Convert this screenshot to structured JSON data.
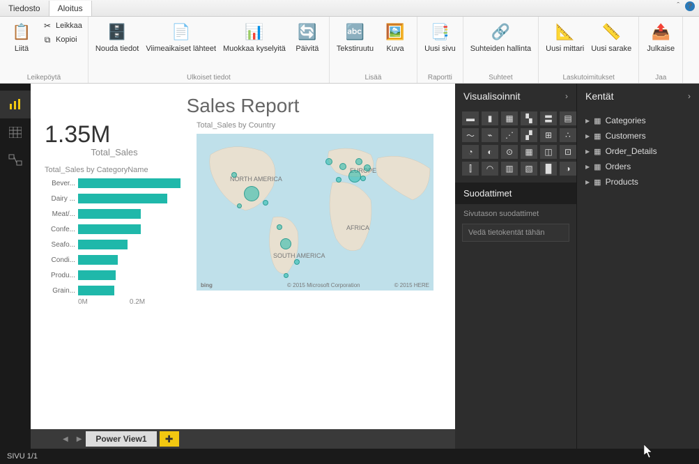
{
  "menu": {
    "file": "Tiedosto",
    "home": "Aloitus"
  },
  "ribbon": {
    "clipboard": {
      "paste": "Liitä",
      "cut": "Leikkaa",
      "copy": "Kopioi",
      "group": "Leikepöytä"
    },
    "external": {
      "getdata": "Nouda tiedot",
      "recent": "Viimeaikaiset lähteet",
      "edit": "Muokkaa kyselyitä",
      "refresh": "Päivitä",
      "group": "Ulkoiset tiedot"
    },
    "insert": {
      "textbox": "Tekstiruutu",
      "image": "Kuva",
      "group": "Lisää"
    },
    "report": {
      "newpage": "Uusi sivu",
      "group": "Raportti"
    },
    "relations": {
      "manage": "Suhteiden hallinta",
      "group": "Suhteet"
    },
    "calc": {
      "measure": "Uusi mittari",
      "column": "Uusi sarake",
      "group": "Laskutoimitukset"
    },
    "share": {
      "publish": "Julkaise",
      "group": "Jaa"
    }
  },
  "panels": {
    "viz_title": "Visualisoinnit",
    "fields_title": "Kentät",
    "filters_title": "Suodattimet",
    "page_filters": "Sivutason suodattimet",
    "drop_hint": "Vedä tietokentät tähän"
  },
  "fields": [
    "Categories",
    "Customers",
    "Order_Details",
    "Orders",
    "Products"
  ],
  "report": {
    "title": "Sales Report",
    "kpi_value": "1.35M",
    "kpi_label": "Total_Sales",
    "bar_title": "Total_Sales by CategoryName",
    "map_title": "Total_Sales by Country"
  },
  "chart_data": {
    "type": "bar",
    "title": "Total_Sales by CategoryName",
    "xlabel": "",
    "ylabel": "",
    "xlim": [
      0,
      0.28
    ],
    "ticks": [
      "0M",
      "0.2M"
    ],
    "categories": [
      "Bever...",
      "Dairy ...",
      "Meat/...",
      "Confe...",
      "Seafo...",
      "Condi...",
      "Produ...",
      "Grain..."
    ],
    "values": [
      0.27,
      0.235,
      0.165,
      0.165,
      0.13,
      0.105,
      0.1,
      0.095
    ]
  },
  "map": {
    "continents": [
      "NORTH AMERICA",
      "SOUTH AMERICA",
      "EUROPE",
      "AFRICA"
    ],
    "bing": "bing",
    "attr1": "© 2015 Microsoft Corporation",
    "attr2": "© 2015 HERE"
  },
  "tabs": {
    "page1": "Power View1"
  },
  "status": "SIVU 1/1"
}
